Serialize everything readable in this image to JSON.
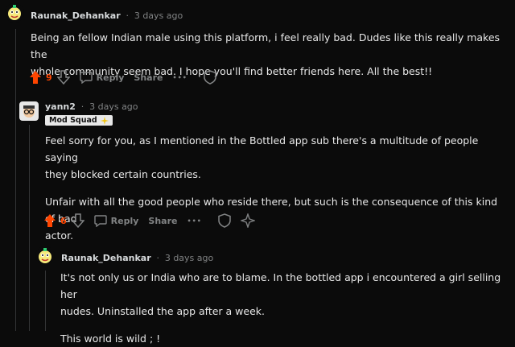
{
  "comments": [
    {
      "username": "Raunak_Dehankar",
      "time": "3 days ago",
      "paragraphs": [
        "Being an fellow Indian male using this platform, i feel really bad. Dudes like this really makes the",
        "whole community seem bad. I hope you'll find better friends here. All the best!!"
      ],
      "score": "9",
      "reply_label": "Reply",
      "share_label": "Share"
    },
    {
      "username": "yann2",
      "time": "3 days ago",
      "flair": "Mod Squad",
      "paragraphs": [
        "Feel sorry for you, as I mentioned in the Bottled app sub there's a multitude of people saying",
        "they blocked certain countries.",
        "Unfair with all the good people who reside there, but such is the consequence of this kind of bad",
        "actor."
      ],
      "score": "6",
      "reply_label": "Reply",
      "share_label": "Share"
    },
    {
      "username": "Raunak_Dehankar",
      "time": "3 days ago",
      "paragraphs": [
        "It's not only us or India who are to blame. In the bottled app i encountered a girl selling her",
        "nudes. Uninstalled the app after a week.",
        "This world is wild ; !"
      ]
    }
  ],
  "colors": {
    "upvote": "#ff4500",
    "background": "#0b0b0b",
    "text": "#d7dadc",
    "muted": "#818384"
  },
  "separator": "·",
  "more_glyph": "•••"
}
